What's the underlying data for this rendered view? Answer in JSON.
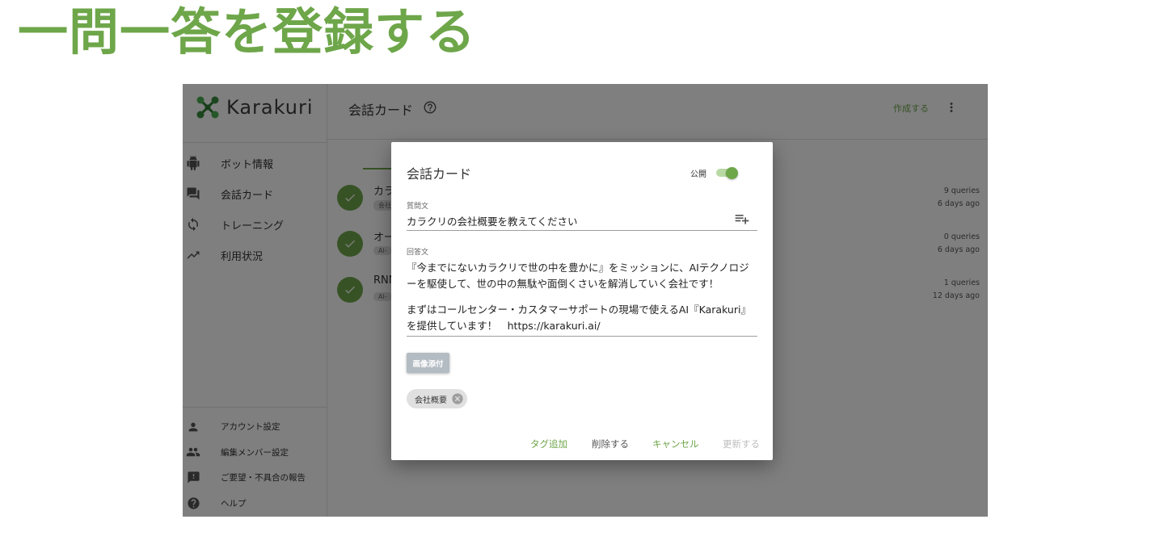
{
  "slide": {
    "title": "一問一答を登録する"
  },
  "app": {
    "brand": "Karakuri",
    "nav": [
      {
        "label": "ボット情報",
        "icon": "android-icon"
      },
      {
        "label": "会話カード",
        "icon": "chat-icon"
      },
      {
        "label": "トレーニング",
        "icon": "sync-icon"
      },
      {
        "label": "利用状況",
        "icon": "trending-up-icon"
      }
    ],
    "nav_bottom": [
      {
        "label": "アカウント設定",
        "icon": "person-icon"
      },
      {
        "label": "編集メンバー設定",
        "icon": "people-icon"
      },
      {
        "label": "ご要望・不具合の報告",
        "icon": "feedback-icon"
      },
      {
        "label": "ヘルプ",
        "icon": "help-icon"
      }
    ],
    "header": {
      "title": "会話カード",
      "create": "作成する"
    },
    "rows": [
      {
        "title": "カラ",
        "chip": "会社",
        "queries": "9 queries",
        "date": "6 days ago"
      },
      {
        "title": "オー",
        "chip": "AI-",
        "queries": "0 queries",
        "date": "6 days ago"
      },
      {
        "title": "RNN",
        "chip": "AI-",
        "queries": "1 queries",
        "date": "12 days ago"
      }
    ]
  },
  "dialog": {
    "title": "会話カード",
    "public_label": "公開",
    "public_on": true,
    "question_label": "質問文",
    "question_value": "カラクリの会社概要を教えてください",
    "answer_label": "回答文",
    "answer_lines": [
      "『今までにないカラクリで世の中を豊かに』をミッションに、AIテクノロジ",
      "ーを駆使して、世の中の無駄や面倒くさいを解消していく会社です！",
      "まずはコールセンター・カスタマーサポートの現場で使えるAI『Karakuri』",
      "を提供しています！　https://karakuri.ai/"
    ],
    "image_button": "画像添付",
    "tag": "会社概要",
    "actions": {
      "add_tag": "タグ追加",
      "delete": "削除する",
      "cancel": "キャンセル",
      "update": "更新する"
    },
    "colors": {
      "accent": "#6ea64a",
      "disabled": "#bdbdbd",
      "text": "#555555"
    }
  }
}
